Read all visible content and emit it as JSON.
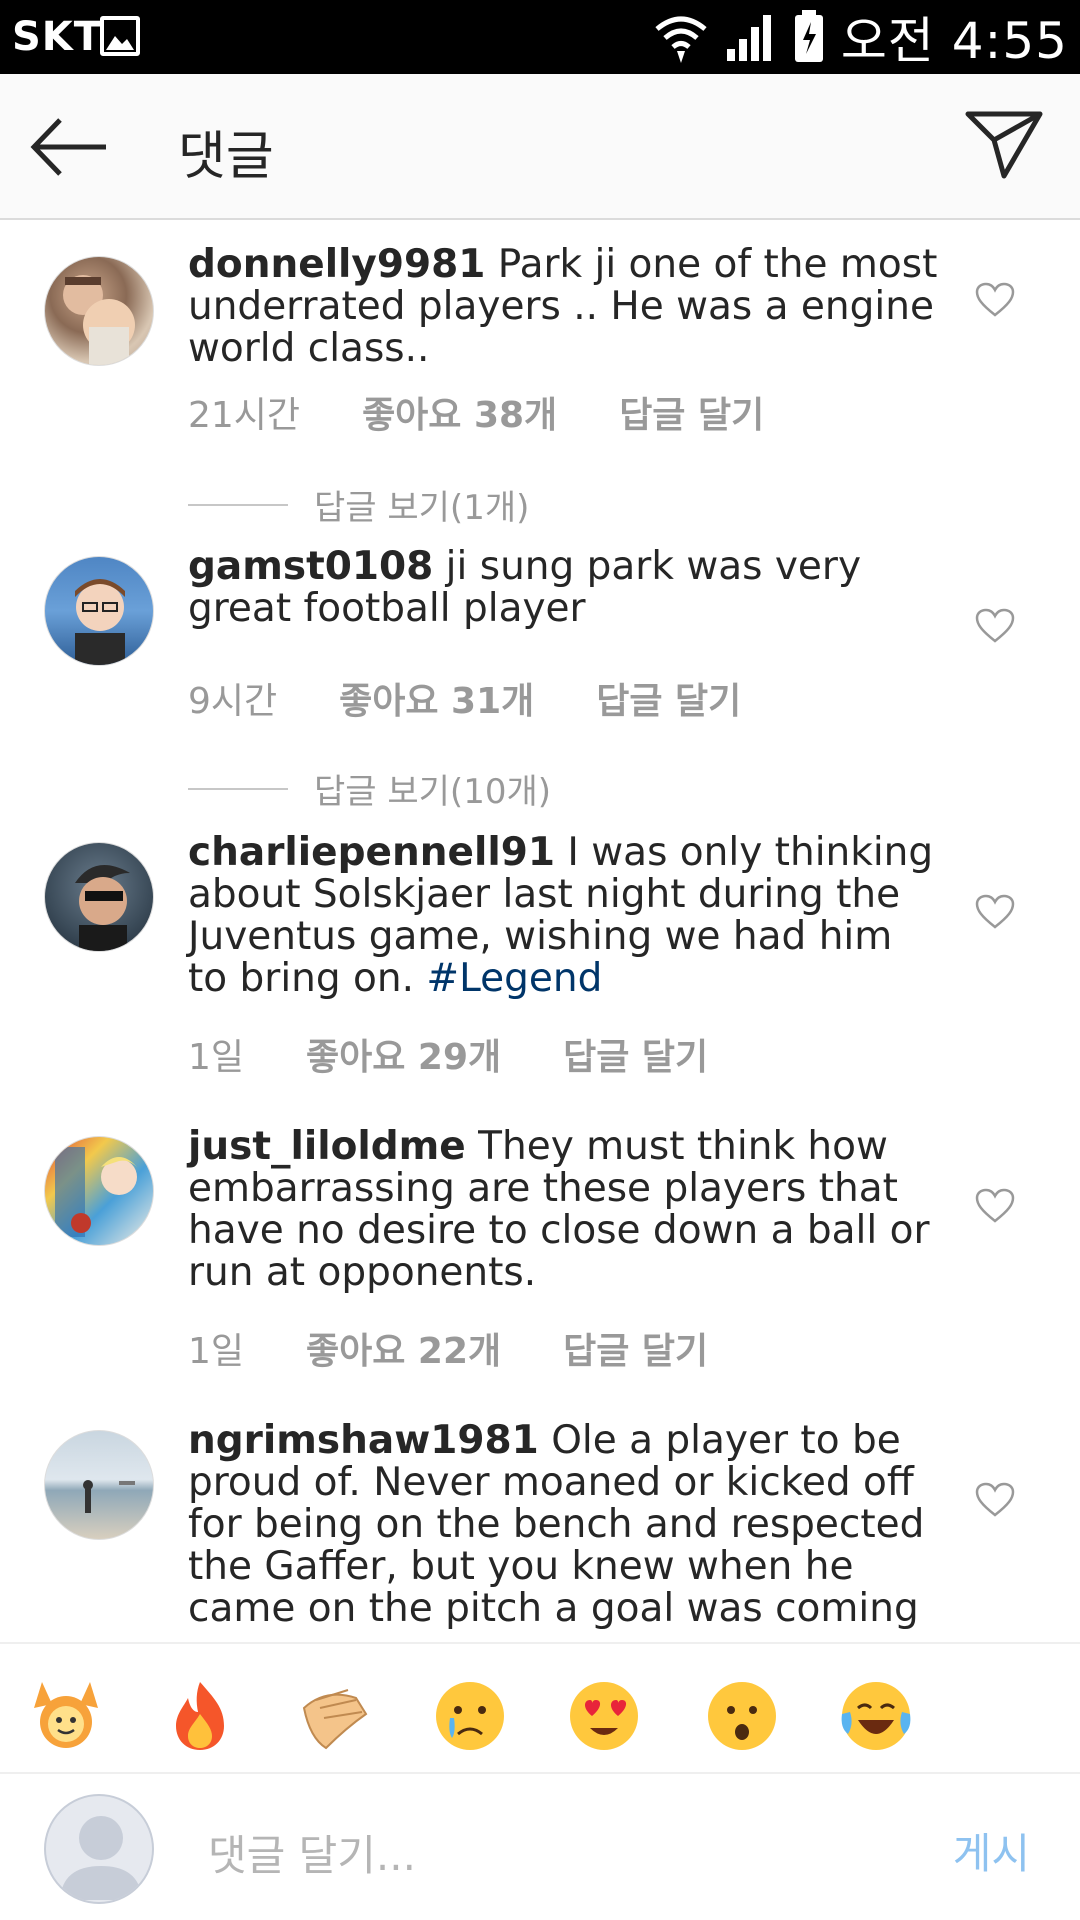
{
  "status": {
    "carrier": "SKT",
    "time": "오전 4:55"
  },
  "header": {
    "title": "댓글"
  },
  "comments": [
    {
      "user": "donnelly9981",
      "text": " Park ji one of the most underrated players .. He was a engine world class..",
      "time": "21시간",
      "likes": "좋아요 38개",
      "reply": "답글 달기",
      "view_replies": "답글 보기(1개)"
    },
    {
      "user": "gamst0108",
      "text": " ji sung park was very great football player",
      "time": "9시간",
      "likes": "좋아요 31개",
      "reply": "답글 달기",
      "view_replies": "답글 보기(10개)"
    },
    {
      "user": "charliepennell91",
      "text": " I was only thinking about Solskjaer last night during the Juventus game, wishing we had him to bring on. ",
      "hashtag": "#Legend",
      "time": "1일",
      "likes": "좋아요 29개",
      "reply": "답글 달기"
    },
    {
      "user": "just_liloldme",
      "text": " They must think how embarrassing are these players that have no desire to close down a ball or run at opponents.",
      "time": "1일",
      "likes": "좋아요 22개",
      "reply": "답글 달기"
    },
    {
      "user": "ngrimshaw1981",
      "text": " Ole a player to be proud of. Never moaned or kicked off for being on the bench and respected the Gaffer, but you knew when he came on the pitch a goal was coming"
    }
  ],
  "emoji_bar": [
    "raising-hands",
    "fire",
    "clapping-hands",
    "crying-face",
    "heart-eyes-face",
    "surprised-face",
    "tears-of-joy-face"
  ],
  "input": {
    "placeholder": "댓글 달기...",
    "post_label": "게시"
  },
  "colors": {
    "hashtag": "#003569",
    "post_disabled": "#8ec2f0",
    "meta_gray": "#999999"
  }
}
